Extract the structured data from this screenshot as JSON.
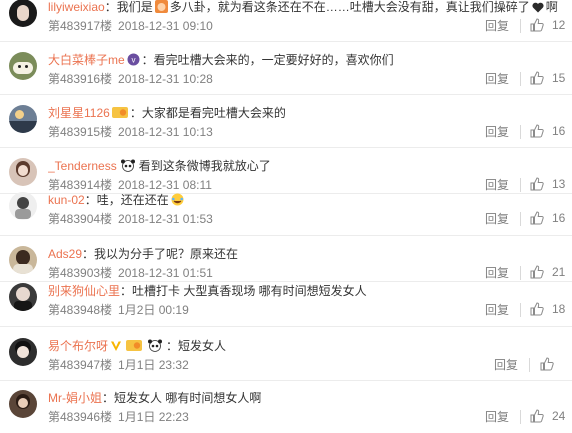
{
  "actions": {
    "reply_label": "回复"
  },
  "comments": [
    {
      "user": "lilyiweixiao",
      "text_a": "我们是",
      "text_b": "多八卦，就为看这条还在不在……吐槽大会没有甜，真让我们操碎了",
      "text_c": "啊",
      "floor": "第483917楼",
      "time": "2018-12-31 09:10",
      "likes": "12",
      "avatar_color": "#1a1a1a"
    },
    {
      "user": "大白菜棒子me",
      "text_a": "：看完吐槽大会来的，一定要好好的，喜欢你们",
      "floor": "第483916楼",
      "time": "2018-12-31 10:28",
      "likes": "15",
      "avatar_color": "#7b8c5a"
    },
    {
      "user": "刘星星1126",
      "text_a": "：大家都是看完吐槽大会来的",
      "floor": "第483915楼",
      "time": "2018-12-31 10:13",
      "likes": "16",
      "avatar_color": "#6d7f95"
    },
    {
      "user": "_Tenderness",
      "text_a": "看到这条微博我就放心了",
      "floor": "第483914楼",
      "time": "2018-12-31 08:11",
      "likes": "13",
      "avatar_color": "#d8c4b8"
    },
    {
      "user": "kun-02",
      "text_a": "：哇，还在还在",
      "floor": "第483904楼",
      "time": "2018-12-31 01:53",
      "likes": "16",
      "avatar_color": "#efefef"
    },
    {
      "user": "Ads29",
      "text_a": "：我以为分手了呢？原来还在",
      "floor": "第483903楼",
      "time": "2018-12-31 01:51",
      "likes": "21",
      "avatar_color": "#c9b79a"
    },
    {
      "user": "别来狗仙心里",
      "text_a": "：吐槽打卡 大型真香现场 哪有时间想短发女人",
      "floor": "第483948楼",
      "time": "1月2日 00:19",
      "likes": "18",
      "avatar_color": "#3a3a3a"
    },
    {
      "user": "易个布尔呀",
      "text_a": "：短发女人",
      "floor": "第483947楼",
      "time": "1月1日 23:32",
      "likes": "",
      "avatar_color": "#2d2d2d"
    },
    {
      "user": "Mr-娟小姐",
      "text_a": "：短发女人 哪有时间想女人啊",
      "floor": "第483946楼",
      "time": "1月1日 22:23",
      "likes": "24",
      "avatar_color": "#5a4538"
    }
  ]
}
